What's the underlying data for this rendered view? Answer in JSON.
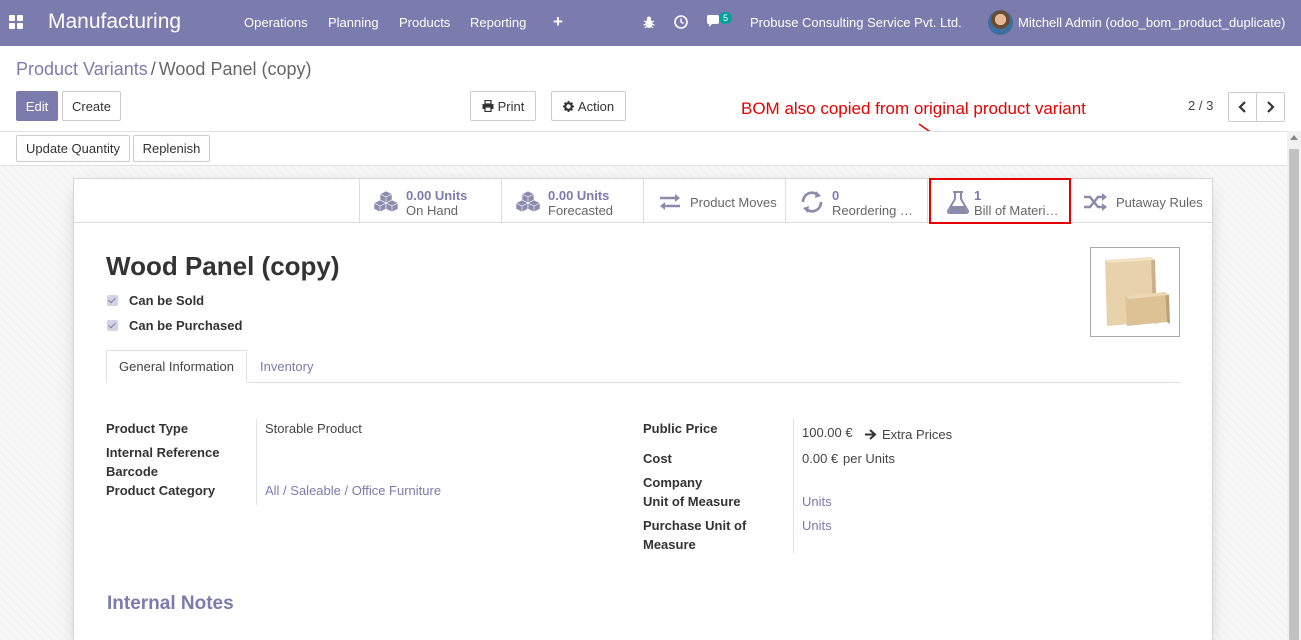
{
  "navbar": {
    "brand": "Manufacturing",
    "menu": [
      "Operations",
      "Planning",
      "Products",
      "Reporting"
    ],
    "plus": "+",
    "messages_count": "5",
    "company": "Probuse Consulting Service Pvt. Ltd.",
    "user": "Mitchell Admin (odoo_bom_product_duplicate)"
  },
  "breadcrumb": {
    "parent": "Product Variants",
    "separator": "/",
    "current": "Wood Panel (copy)"
  },
  "toolbar": {
    "edit": "Edit",
    "create": "Create",
    "print": "Print",
    "action": "Action",
    "pager": "2 / 3"
  },
  "annotation": "BOM also copied from original product variant",
  "statusbar": {
    "update_quantity": "Update Quantity",
    "replenish": "Replenish"
  },
  "smart_buttons": [
    {
      "value": "0.00 Units",
      "label": "On Hand",
      "icon": "cubes-icon"
    },
    {
      "value": "0.00 Units",
      "label": "Forecasted",
      "icon": "cubes-icon"
    },
    {
      "value": "",
      "label": "Product Moves",
      "icon": "exchange-icon"
    },
    {
      "value": "0",
      "label": "Reordering …",
      "icon": "refresh-icon"
    },
    {
      "value": "1",
      "label": "Bill of Materi…",
      "icon": "flask-icon"
    },
    {
      "value": "",
      "label": "Putaway Rules",
      "icon": "random-icon"
    }
  ],
  "product": {
    "name": "Wood Panel (copy)",
    "can_be_sold": "Can be Sold",
    "can_be_purchased": "Can be Purchased"
  },
  "tabs": {
    "general": "General Information",
    "inventory": "Inventory"
  },
  "left_fields": {
    "product_type_label": "Product Type",
    "product_type": "Storable Product",
    "internal_reference_label": "Internal Reference",
    "barcode_label": "Barcode",
    "category_label": "Product Category",
    "category": "All / Saleable / Office Furniture"
  },
  "right_fields": {
    "public_price_label": "Public Price",
    "public_price": "100.00 €",
    "extra_prices": "Extra Prices",
    "cost_label": "Cost",
    "cost": "0.00 €",
    "cost_unit": "per Units",
    "company_label": "Company",
    "uom_label": "Unit of Measure",
    "uom": "Units",
    "purchase_uom_label_1": "Purchase Unit of",
    "purchase_uom_label_2": "Measure",
    "purchase_uom": "Units"
  },
  "notes_title": "Internal Notes",
  "colors": {
    "primary": "#7c7bad",
    "annotation": "#e60000",
    "badge": "#00a09d"
  }
}
